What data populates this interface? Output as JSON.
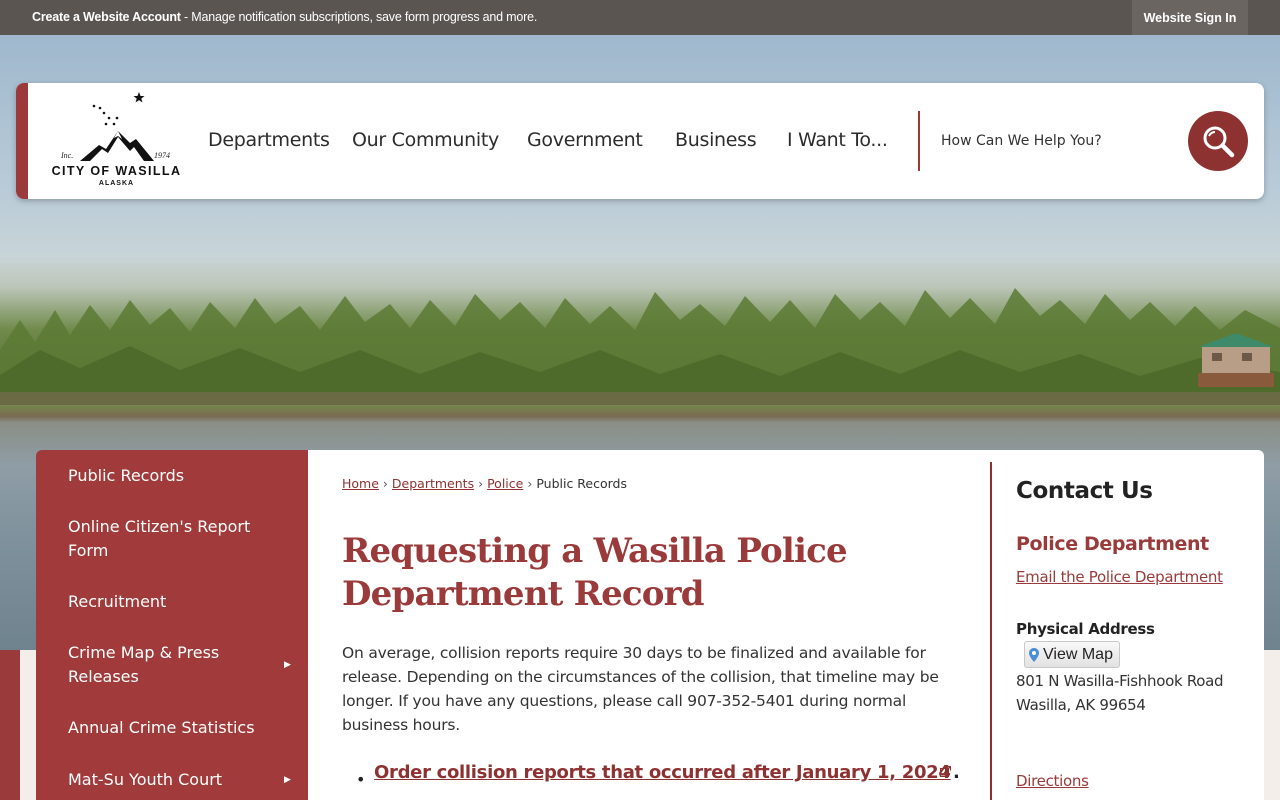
{
  "topbar": {
    "account_strong": "Create a Website Account",
    "account_rest": " - Manage notification subscriptions, save form progress and more.",
    "signin_label": "Website Sign In"
  },
  "logo": {
    "name": "CITY OF WASILLA",
    "state": "ALASKA",
    "inc": "Inc.",
    "year": "1974"
  },
  "nav": {
    "items": [
      "Departments",
      "Our Community",
      "Government",
      "Business",
      "I Want To..."
    ]
  },
  "search": {
    "placeholder": "How Can We Help You?",
    "icon": "search-icon"
  },
  "sidebar": {
    "items": [
      {
        "label": "Public Records",
        "has_submenu": false
      },
      {
        "label": "Online Citizen's Report Form",
        "has_submenu": false
      },
      {
        "label": "Recruitment",
        "has_submenu": false
      },
      {
        "label": "Crime Map & Press Releases",
        "has_submenu": true
      },
      {
        "label": "Annual Crime Statistics",
        "has_submenu": false
      },
      {
        "label": "Mat-Su Youth Court",
        "has_submenu": true
      }
    ]
  },
  "breadcrumb": {
    "items": [
      "Home",
      "Departments",
      "Police"
    ],
    "separator": "›",
    "current": "Public Records"
  },
  "main": {
    "title": "Requesting a Wasilla Police Department Record",
    "intro": "On average, collision reports require 30 days to be finalized and available for release. Depending on the circumstances of the collision, that timeline may be longer. If you have any questions, please call 907-352-5401 during normal business hours.",
    "bullet_link": "Order collision reports that occurred after January 1, 2024",
    "bullet_suffix": "."
  },
  "contact": {
    "title": "Contact Us",
    "dept": "Police Department",
    "email_link": "Email the Police Department",
    "address_label": "Physical Address",
    "map_button": "View Map",
    "address_line1": "801 N Wasilla-Fishhook Road",
    "address_line2": "Wasilla, AK 99654",
    "directions": "Directions"
  },
  "colors": {
    "brand_red": "#9a3a3a",
    "topbar": "#5b5552",
    "sidebar": "#a13b3b"
  }
}
